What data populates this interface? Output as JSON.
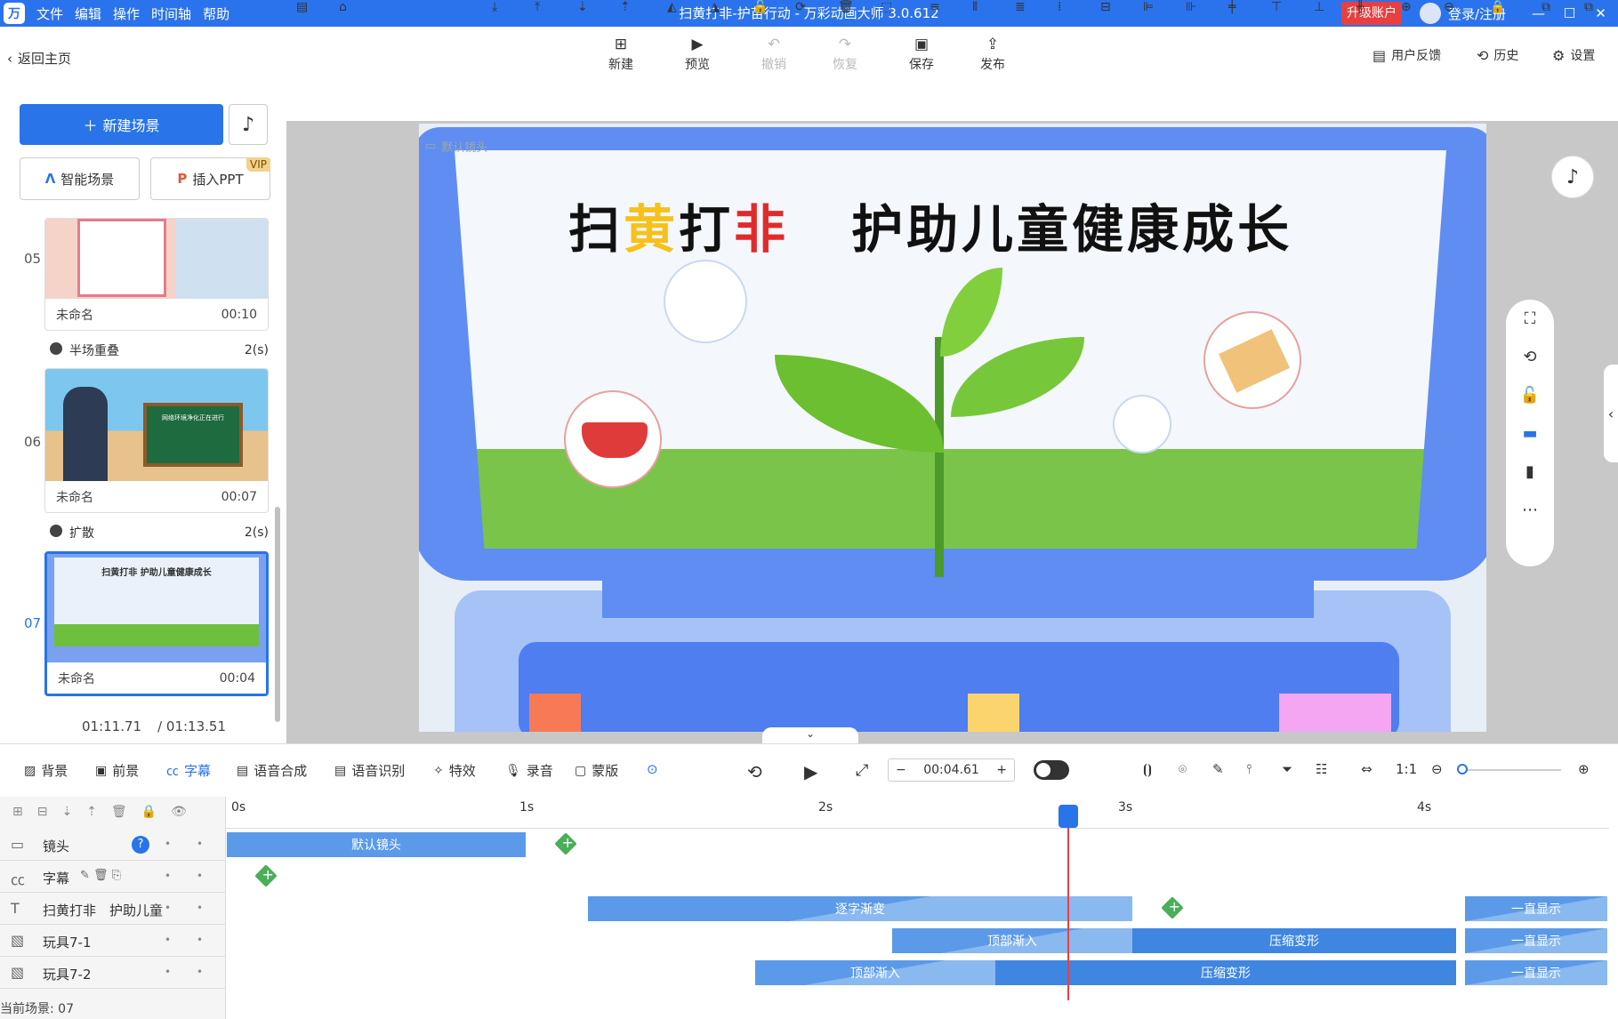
{
  "app": {
    "menu": [
      "文件",
      "编辑",
      "操作",
      "时间轴",
      "帮助"
    ],
    "title": "扫黄打非-护苗行动 - 万彩动画大师 3.0.612",
    "upgrade": "升级账户",
    "login": "登录/注册",
    "window_buttons": [
      "—",
      "☐",
      "✕"
    ]
  },
  "toolbar": {
    "back": "返回主页",
    "actions": [
      {
        "label": "新建",
        "icon": "plus-icon",
        "enabled": true
      },
      {
        "label": "预览",
        "icon": "play-icon",
        "enabled": true
      },
      {
        "label": "撤销",
        "icon": "undo-icon",
        "enabled": false
      },
      {
        "label": "恢复",
        "icon": "redo-icon",
        "enabled": false
      },
      {
        "label": "保存",
        "icon": "save-icon",
        "enabled": true
      },
      {
        "label": "发布",
        "icon": "publish-icon",
        "enabled": true
      }
    ],
    "right": [
      "用户反馈",
      "历史",
      "设置"
    ]
  },
  "left": {
    "new_scene": "新建场景",
    "smart_scene": "智能场景",
    "insert_ppt": "插入PPT",
    "vip": "VIP",
    "scenes": [
      {
        "num": "05",
        "name": "未命名",
        "duration": "00:10"
      },
      {
        "num": "06",
        "name": "未命名",
        "duration": "00:07"
      },
      {
        "num": "07",
        "name": "未命名",
        "duration": "00:04"
      }
    ],
    "transitions": [
      {
        "name": "半场重叠",
        "duration": "2(s)"
      },
      {
        "name": "扩散",
        "duration": "2(s)"
      }
    ],
    "time_current": "01:11.71",
    "time_total": "/ 01:13.51"
  },
  "stage": {
    "camera_label": "默认镜头",
    "headline_part1": "扫",
    "headline_part2": "黄",
    "headline_part3": "打",
    "headline_part4": "非",
    "headline_part5": "护助儿童健康成长",
    "thumb_title": "扫黄打非 护助儿童健康成长",
    "thumb06_text": "网络环境净化正在进行"
  },
  "timeline": {
    "tabs": [
      {
        "label": "背景",
        "active": false
      },
      {
        "label": "前景",
        "active": false
      },
      {
        "label": "字幕",
        "active": true
      },
      {
        "label": "语音合成",
        "active": false
      },
      {
        "label": "语音识别",
        "active": false
      },
      {
        "label": "特效",
        "active": false
      },
      {
        "label": "录音",
        "active": false
      },
      {
        "label": "蒙版",
        "active": false
      }
    ],
    "current_time": "00:04.61",
    "ticks": [
      "0s",
      "1s",
      "2s",
      "3s",
      "4s"
    ],
    "rows": [
      {
        "label": "镜头",
        "bars": [
          {
            "text": "默认镜头"
          }
        ]
      },
      {
        "label": "字幕",
        "bars": []
      },
      {
        "label": "扫黄打非　护助儿童",
        "bars": [
          {
            "text": "逐字渐变"
          },
          {
            "text": "一直显示"
          }
        ]
      },
      {
        "label": "玩具7-1",
        "bars": [
          {
            "text": "顶部渐入"
          },
          {
            "text": "压缩变形"
          },
          {
            "text": "一直显示"
          }
        ]
      },
      {
        "label": "玩具7-2",
        "bars": [
          {
            "text": "顶部渐入"
          },
          {
            "text": "压缩变形"
          },
          {
            "text": "一直显示"
          }
        ]
      }
    ],
    "status": "当前场景: 07"
  }
}
